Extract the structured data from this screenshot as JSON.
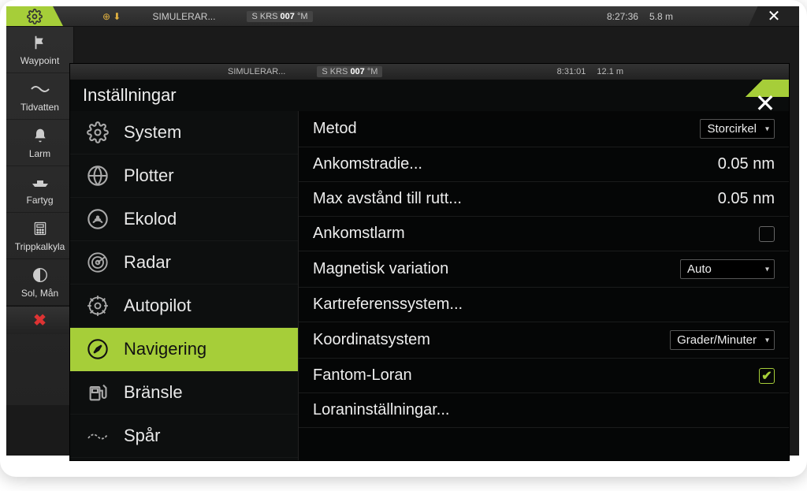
{
  "status_bg": {
    "simulate": "SIMULERAR...",
    "krs_prefix": "S KRS",
    "krs_value": "007",
    "krs_unit": "°M",
    "time": "8:27:36",
    "depth": "5.8 m"
  },
  "status_front": {
    "simulate": "SIMULERAR...",
    "krs_prefix": "S KRS",
    "krs_value": "007",
    "krs_unit": "°M",
    "time": "8:31:01",
    "depth": "12.1 m"
  },
  "rail": {
    "items": [
      {
        "label": "Waypoint"
      },
      {
        "label": "Tidvatten"
      },
      {
        "label": "Larm"
      },
      {
        "label": "Fartyg"
      },
      {
        "label": "Trippkalkyla"
      },
      {
        "label": "Sol, Mån"
      }
    ]
  },
  "settings": {
    "title": "Inställningar",
    "categories": [
      {
        "label": "System"
      },
      {
        "label": "Plotter"
      },
      {
        "label": "Ekolod"
      },
      {
        "label": "Radar"
      },
      {
        "label": "Autopilot"
      },
      {
        "label": "Navigering"
      },
      {
        "label": "Bränsle"
      },
      {
        "label": "Spår"
      }
    ],
    "rows": {
      "method": {
        "label": "Metod",
        "value": "Storcirkel"
      },
      "arrival_radius": {
        "label": "Ankomstradie...",
        "value": "0.05 nm"
      },
      "max_xte": {
        "label": "Max avstånd till rutt...",
        "value": "0.05 nm"
      },
      "arrival_alarm": {
        "label": "Ankomstlarm"
      },
      "mag_var": {
        "label": "Magnetisk variation",
        "value": "Auto"
      },
      "datum": {
        "label": "Kartreferenssystem..."
      },
      "coord": {
        "label": "Koordinatsystem",
        "value": "Grader/Minuter"
      },
      "phantom_loran": {
        "label": "Fantom-Loran"
      },
      "loran_settings": {
        "label": "Loraninställningar..."
      }
    }
  }
}
